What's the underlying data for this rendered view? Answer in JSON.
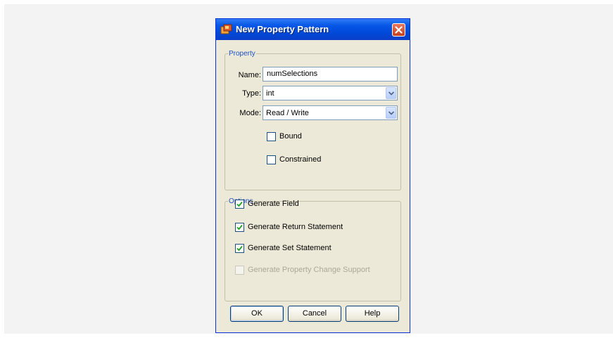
{
  "dialog": {
    "title": "New Property Pattern"
  },
  "property_group": {
    "legend": "Property",
    "name_label": "Name:",
    "name_value": "numSelections",
    "type_label": "Type:",
    "type_value": "int",
    "mode_label": "Mode:",
    "mode_value": "Read / Write",
    "bound_label": "Bound",
    "bound_checked": false,
    "constrained_label": "Constrained",
    "constrained_checked": false
  },
  "options_group": {
    "legend": "Options",
    "items": [
      {
        "label": "Generate Field",
        "checked": true,
        "enabled": true
      },
      {
        "label": "Generate Return Statement",
        "checked": true,
        "enabled": true
      },
      {
        "label": "Generate Set Statement",
        "checked": true,
        "enabled": true
      },
      {
        "label": "Generate Property Change Support",
        "checked": false,
        "enabled": false
      }
    ]
  },
  "buttons": {
    "ok": "OK",
    "cancel": "Cancel",
    "help": "Help"
  },
  "colors": {
    "titlebar": "#0758e8",
    "dialog_bg": "#ece9d8",
    "legend": "#1c4fc3",
    "close": "#d9532e"
  },
  "icons": {
    "app": "netbeans-app-icon",
    "close": "close-icon",
    "dropdown": "chevron-down-icon",
    "check": "checkmark-icon"
  }
}
